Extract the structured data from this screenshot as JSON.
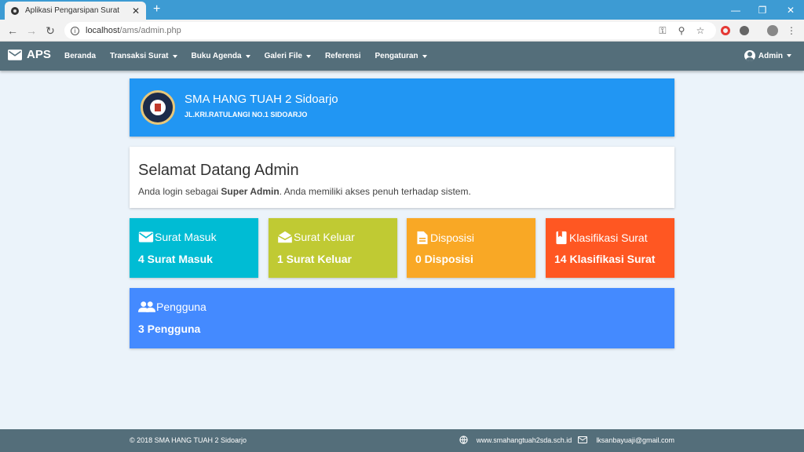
{
  "browser": {
    "tab_title": "Aplikasi Pengarsipan Surat",
    "url_host": "localhost",
    "url_path": "/ams/admin.php"
  },
  "navbar": {
    "brand": "APS",
    "menu": [
      {
        "label": "Beranda",
        "dropdown": false
      },
      {
        "label": "Transaksi Surat",
        "dropdown": true
      },
      {
        "label": "Buku Agenda",
        "dropdown": true
      },
      {
        "label": "Galeri File",
        "dropdown": true
      },
      {
        "label": "Referensi",
        "dropdown": false
      },
      {
        "label": "Pengaturan",
        "dropdown": true
      }
    ],
    "user": "Admin"
  },
  "header": {
    "school_name": "SMA HANG TUAH 2 Sidoarjo",
    "address": "JL.KRI.RATULANGI NO.1 SIDOARJO"
  },
  "welcome": {
    "title": "Selamat Datang Admin",
    "text_before": "Anda login sebagai ",
    "role": "Super Admin",
    "text_after": ". Anda memiliki akses penuh terhadap sistem."
  },
  "stats": [
    {
      "label": "Surat Masuk",
      "value": "4 Surat Masuk",
      "color": "#00bcd4",
      "icon": "mail-icon"
    },
    {
      "label": "Surat Keluar",
      "value": "1 Surat Keluar",
      "color": "#c0ca33",
      "icon": "drafts-icon"
    },
    {
      "label": "Disposisi",
      "value": "0 Disposisi",
      "color": "#f9a825",
      "icon": "description-icon"
    },
    {
      "label": "Klasifikasi Surat",
      "value": "14 Klasifikasi Surat",
      "color": "#ff5722",
      "icon": "class-icon"
    },
    {
      "label": "Pengguna",
      "value": "3 Pengguna",
      "color": "#448aff",
      "icon": "people-icon"
    }
  ],
  "footer": {
    "copyright": "© 2018 SMA HANG TUAH 2 Sidoarjo",
    "website": "www.smahangtuah2sda.sch.id",
    "email": "lksanbayuaji@gmail.com"
  }
}
